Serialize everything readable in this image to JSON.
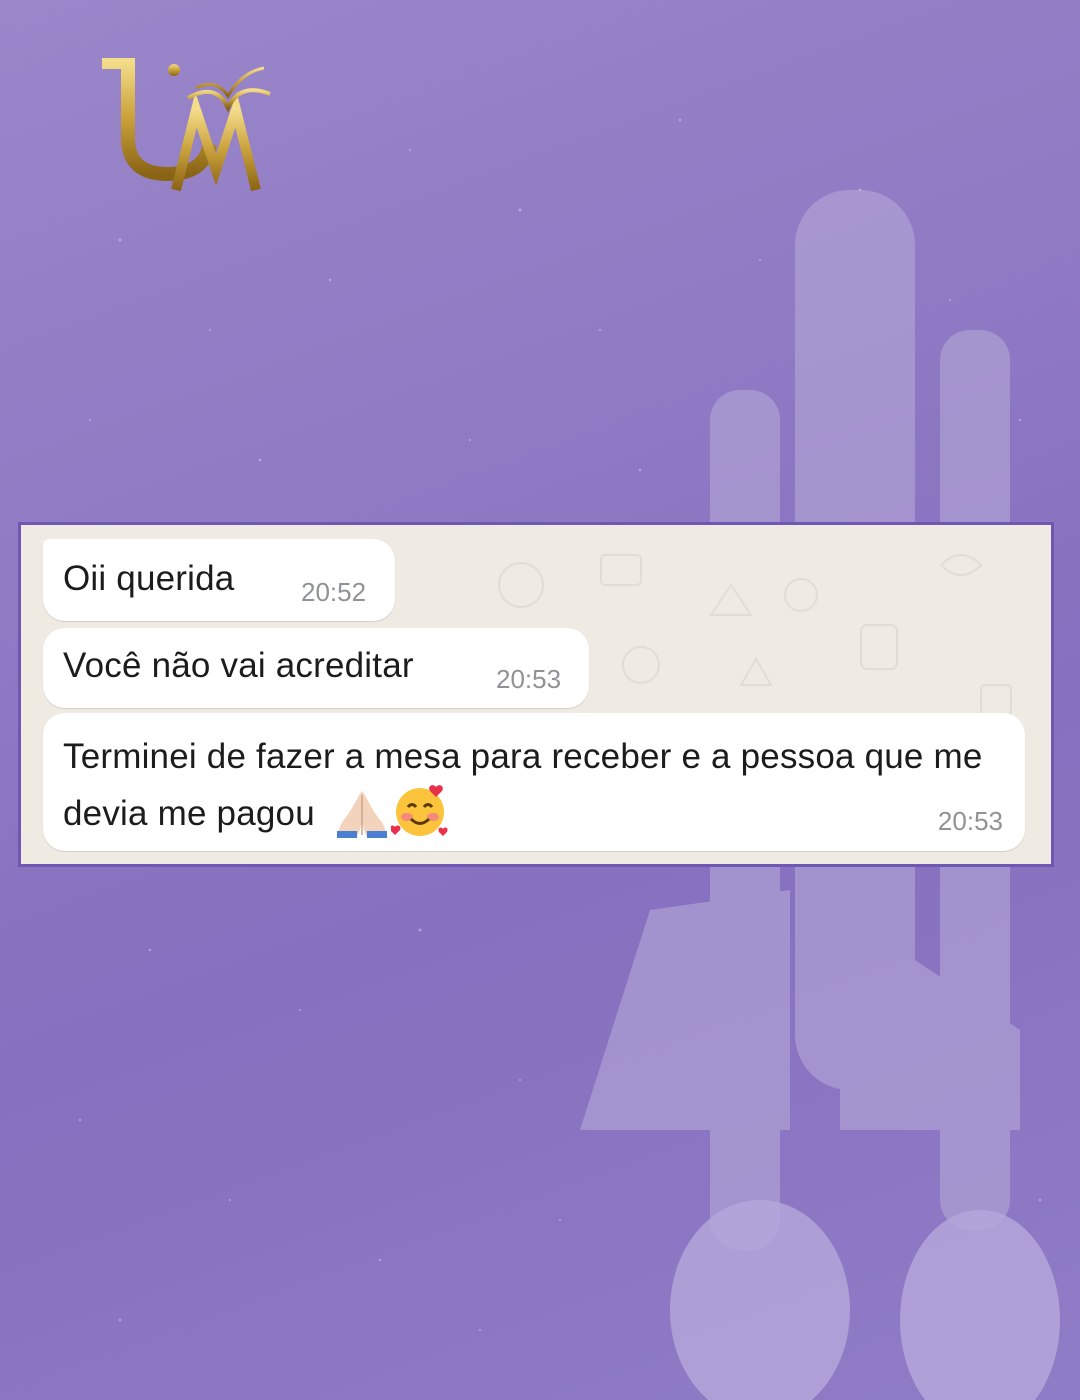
{
  "brand": {
    "logo_text": "UM",
    "logo_color": "#c9a13b"
  },
  "colors": {
    "background": "#8f7ac4",
    "panel_border": "#6f58b3",
    "chat_bg": "#efeae2",
    "bubble": "#ffffff",
    "timestamp": "#8f9396"
  },
  "chat": {
    "messages": [
      {
        "text": "Oii querida",
        "time": "20:52"
      },
      {
        "text": "Você não vai acreditar",
        "time": "20:53"
      },
      {
        "text": "Terminei de fazer a mesa para receber e a pessoa que me devia me pagou",
        "time": "20:53",
        "emojis": [
          "folded-hands-icon",
          "smiling-face-with-hearts-icon"
        ]
      }
    ]
  }
}
